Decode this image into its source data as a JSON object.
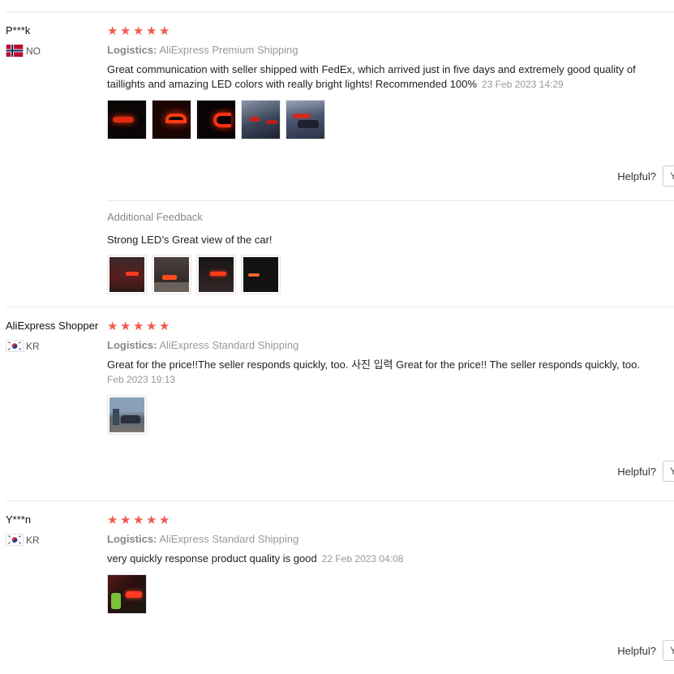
{
  "reviews": [
    {
      "user": "P***k",
      "country_code": "NO",
      "rating": 5,
      "logistics_label": "Logistics:",
      "logistics": "AliExpress Premium Shipping",
      "text": "Great communication with seller shipped with FedEx, which arrived just in five days and extremely good quality of taillights and amazing LED colors with really bright lights! Recommended 100%",
      "date": "23 Feb 2023 14:29",
      "photo_count": 5,
      "helpful_label": "Helpful?",
      "helpful_yes": "Y",
      "additional_feedback": {
        "title": "Additional Feedback",
        "text": "Strong LED’s Great view of the car!",
        "photo_count": 4
      }
    },
    {
      "user": "AliExpress Shopper",
      "country_code": "KR",
      "rating": 5,
      "logistics_label": "Logistics:",
      "logistics": "AliExpress Standard Shipping",
      "text": "Great for the price!!The seller responds quickly, too.  사진 입력 Great for the price!! The seller responds quickly, too.",
      "date": "Feb 2023 19:13",
      "photo_count": 1,
      "helpful_label": "Helpful?",
      "helpful_yes": "Y"
    },
    {
      "user": "Y***n",
      "country_code": "KR",
      "rating": 5,
      "logistics_label": "Logistics:",
      "logistics": "AliExpress Standard Shipping",
      "text": "very quickly response product quality is good",
      "date": "22 Feb 2023 04:08",
      "photo_count": 1,
      "helpful_label": "Helpful?",
      "helpful_yes": "Y"
    }
  ],
  "colors": {
    "star": "#f05a4b",
    "muted": "#999999",
    "border": "#e8e8e8"
  }
}
